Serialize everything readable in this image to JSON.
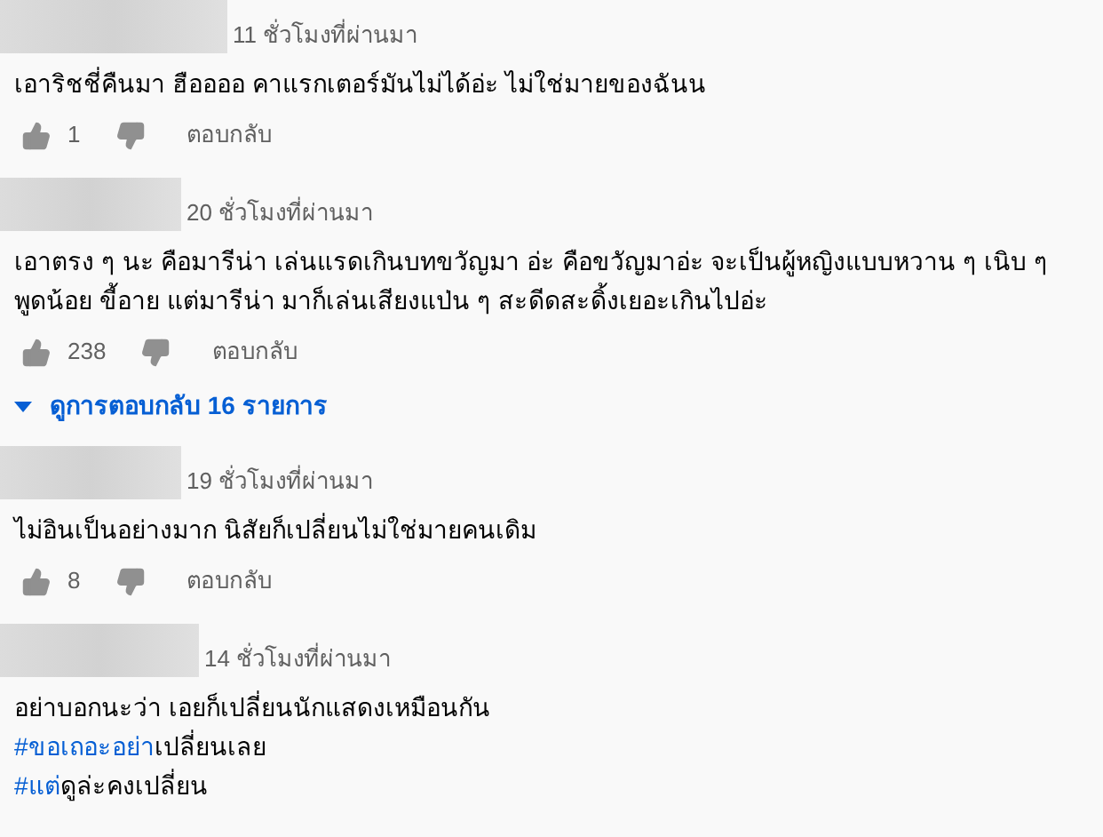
{
  "comments": [
    {
      "time": "11 ชั่วโมงที่ผ่านมา",
      "lines": [
        {
          "text": "เอาริชชี่คืนมา ฮืออออ คาแรกเตอร์มันไม่ได้อ่ะ ไม่ใช่มายของฉันน"
        }
      ],
      "likes": "1",
      "reply": "ตอบกลับ"
    },
    {
      "time": "20 ชั่วโมงที่ผ่านมา",
      "lines": [
        {
          "text": "เอาตรง ๆ นะ คือมารีน่า เล่นแรดเกินบทขวัญมา อ่ะ คือขวัญมาอ่ะ จะเป็นผู้หญิงแบบหวาน ๆ เนิบ ๆ"
        },
        {
          "text": "พูดน้อย ขี้อาย แต่มารีน่า มาก็เล่นเสียงแป่น ๆ สะดีดสะดิ้งเยอะเกินไปอ่ะ"
        }
      ],
      "likes": "238",
      "reply": "ตอบกลับ",
      "replies": "ดูการตอบกลับ 16 รายการ"
    },
    {
      "time": "19 ชั่วโมงที่ผ่านมา",
      "lines": [
        {
          "text": "ไม่อินเป็นอย่างมาก นิสัยก็เปลี่ยนไม่ใช่มายคนเดิม"
        }
      ],
      "likes": "8",
      "reply": "ตอบกลับ"
    },
    {
      "time": "14 ชั่วโมงที่ผ่านมา",
      "lines": [
        {
          "text": "อย่าบอกนะว่า เอยก็เปลี่ยนนักแสดงเหมือนกัน"
        },
        {
          "hashtag": "#ขอเถอะอย่า",
          "text": "เปลี่ยนเลย"
        },
        {
          "hashtag": "#แต่",
          "text": "ดูล่ะคงเปลี่ยน"
        }
      ]
    }
  ]
}
